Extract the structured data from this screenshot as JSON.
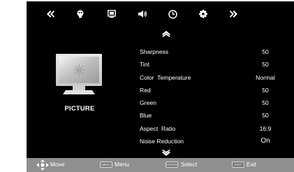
{
  "top_bar": {
    "icons": [
      "double-left-chevron-icon",
      "picture-palette-icon",
      "screen-icon",
      "speaker-icon",
      "clock-icon",
      "gear-icon",
      "double-right-chevron-icon"
    ]
  },
  "sidebar": {
    "title": "PICTURE",
    "icon": "monitor-icon"
  },
  "menu": {
    "items": [
      {
        "label": "Sharpness",
        "value": "50"
      },
      {
        "label": "Tint",
        "value": "50"
      },
      {
        "label": "Color  Temperature",
        "value": "Normal"
      },
      {
        "label": "Red",
        "value": "50"
      },
      {
        "label": "Green",
        "value": "50"
      },
      {
        "label": "Blue",
        "value": "50"
      },
      {
        "label": "Aspect  Ratio",
        "value": "16:9"
      },
      {
        "label": "Noise Reduction",
        "value": "On"
      }
    ]
  },
  "bottom_bar": {
    "move_label": "Move",
    "menu_key": "MENU",
    "menu_label": "Menu",
    "select_key": "ENTER",
    "select_label": "Select",
    "exit_key": "EXIT",
    "exit_label": "Exit"
  },
  "colors": {
    "background": "#000000",
    "bottom_bar": "#8f8f8f",
    "text": "#ffffff",
    "dpad": "#ffffff"
  }
}
